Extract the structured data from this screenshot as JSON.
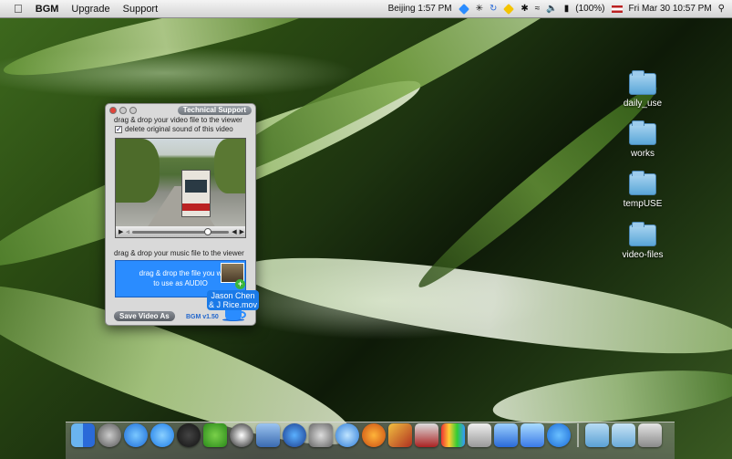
{
  "menubar": {
    "app_name": "BGM",
    "menus": [
      "Upgrade",
      "Support"
    ],
    "location_clock": "Beijing 1:57 PM",
    "battery": "(100%)",
    "datetime": "Fri Mar 30  10:57 PM"
  },
  "desktop": {
    "folders": [
      {
        "label": "daily_use"
      },
      {
        "label": "works"
      },
      {
        "label": "tempUSE"
      },
      {
        "label": "video-files"
      }
    ]
  },
  "window": {
    "tech_support_label": "Technical Support",
    "video_instruction": "drag & drop your video file to the viewer",
    "delete_sound_label": "delete original sound of this video",
    "delete_sound_checked": true,
    "music_instruction": "drag & drop your music file to the viewer",
    "drop_zone_line1": "drag & drop the file you w",
    "drop_zone_line2": "to use as AUDIO",
    "drag_file_name_line1": "Jason Chen",
    "drag_file_name_line2": "& J Rice.mov",
    "save_button": "Save Video As",
    "version": "BGM v1.50"
  },
  "dock": {
    "apps": [
      "finder-icon",
      "launchpad-icon",
      "itunes-icon",
      "app-store-icon",
      "dashboard-icon",
      "messenger-icon",
      "zoom-icon",
      "preview-icon",
      "google-earth-icon",
      "system-prefs-icon",
      "safari-icon",
      "firefox-icon",
      "pencil-icon",
      "rocket-icon",
      "colors-icon",
      "board-icon",
      "xcode-icon",
      "xcode2-icon",
      "bgm-cup-icon"
    ],
    "stacks": [
      "applications-folder-icon",
      "downloads-folder-icon",
      "trash-icon"
    ]
  },
  "colors": {
    "drop_zone": "#2a8cff",
    "accent": "#1a7ae8"
  }
}
